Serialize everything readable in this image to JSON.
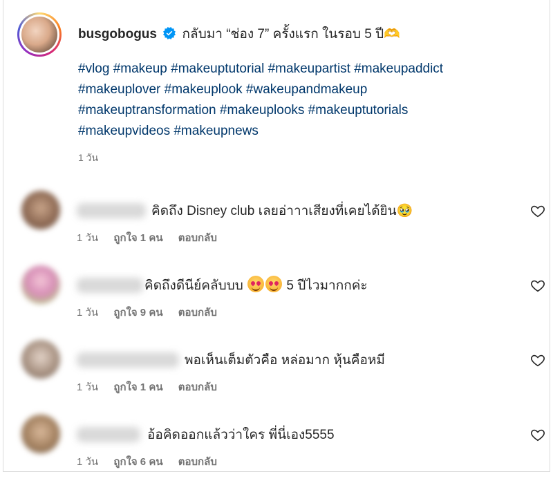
{
  "post": {
    "username": "busgobogus",
    "caption": "กลับมา “ช่อง 7” ครั้งแรก ในรอบ 5 ปี",
    "caption_end": "🫶",
    "hashtag_lines": [
      "#vlog #makeup #makeuptutorial #makeupartist #makeupaddict",
      "#makeuplover #makeuplook #wakeupandmakeup",
      "#makeuptransformation #makeuplooks #makeuptutorials",
      "#makeupvideos #makeupnews"
    ],
    "time": "1 วัน"
  },
  "comments": [
    {
      "text": "คิดถึง Disney club เลยอ่าาาเสียงที่เคยได้ยิน",
      "text_end": "🥹",
      "time": "1 วัน",
      "likes": "ถูกใจ 1 คน",
      "reply": "ตอบกลับ"
    },
    {
      "text": "คิดถึงดีนีย์คลับบบ",
      "text_after": "5 ปีไวมากกค่ะ",
      "emoji": "🥰",
      "time": "1 วัน",
      "likes": "ถูกใจ 9 คน",
      "reply": "ตอบกลับ"
    },
    {
      "text": "พอเห็นเต็มตัวคือ หล่อมาก หุ้นคือหมี",
      "time": "1 วัน",
      "likes": "ถูกใจ 1 คน",
      "reply": "ตอบกลับ"
    },
    {
      "text": "อ้อคิดออกแล้วว่าใคร พี่นี่เอง5555",
      "time": "1 วัน",
      "likes": "ถูกใจ 6 คน",
      "reply": "ตอบกลับ"
    }
  ],
  "colors": {
    "text": "#262626",
    "muted": "#737373",
    "hashtag": "#00376b",
    "verified": "#0095f6"
  },
  "icons": [
    "verified-badge-icon",
    "heart-icon"
  ]
}
